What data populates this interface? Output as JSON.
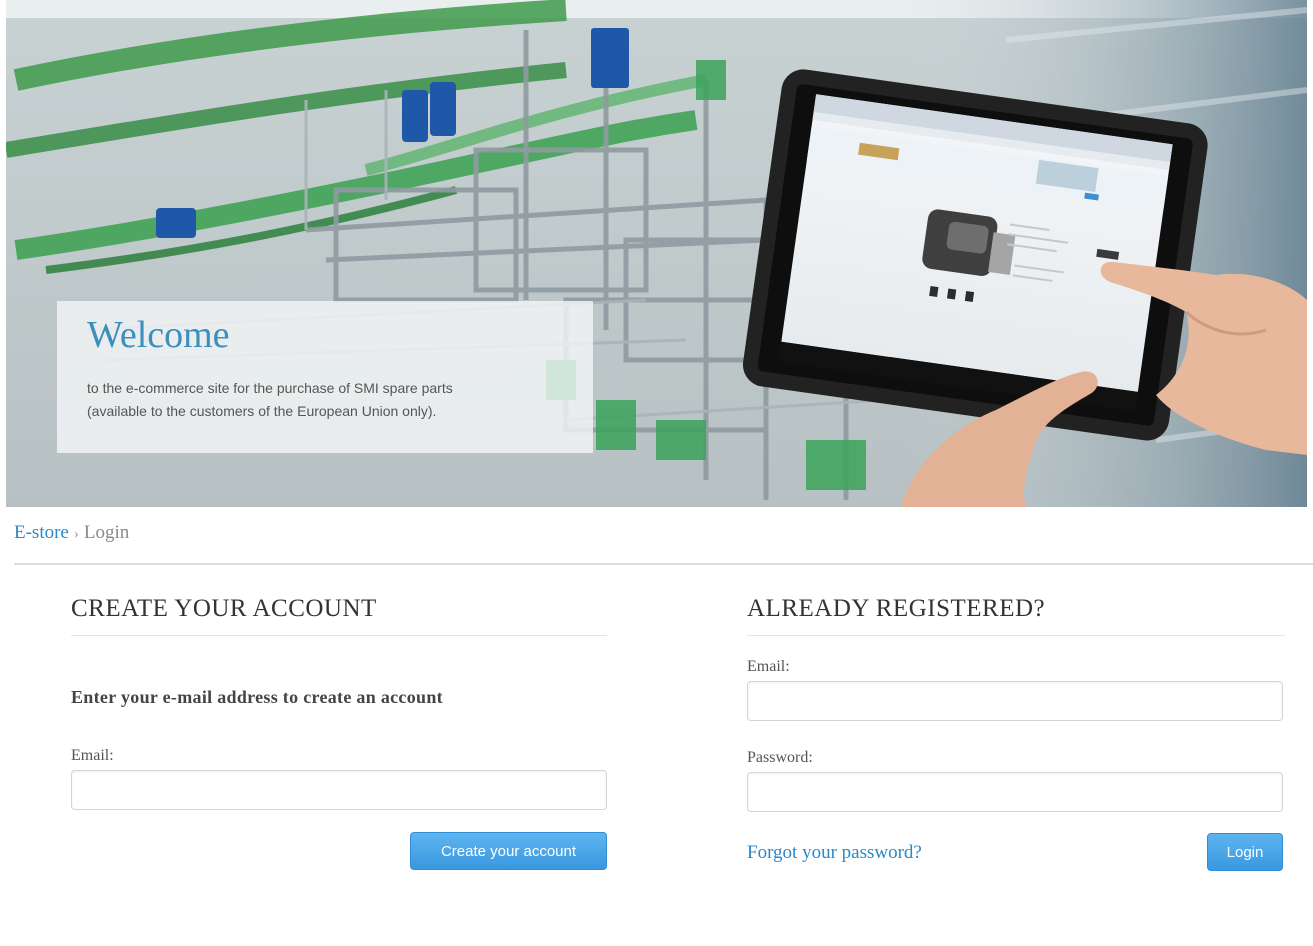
{
  "hero": {
    "title": "Welcome",
    "text_line1": "to the e-commerce site for the purchase of SMI spare parts",
    "text_line2": "(available to the customers of the European Union only)."
  },
  "breadcrumb": {
    "home": "E-store",
    "separator": "›",
    "current": "Login"
  },
  "create_account": {
    "heading": "CREATE YOUR ACCOUNT",
    "subheading": "Enter your e-mail address to create an account",
    "email_label": "Email:",
    "email_value": "",
    "button_label": "Create your account"
  },
  "login": {
    "heading": "ALREADY REGISTERED?",
    "email_label": "Email:",
    "email_value": "",
    "password_label": "Password:",
    "password_value": "",
    "forgot_label": "Forgot your password?",
    "button_label": "Login"
  },
  "colors": {
    "accent": "#3a98e0",
    "link": "#2a88c6",
    "title": "#3b8fbd"
  }
}
